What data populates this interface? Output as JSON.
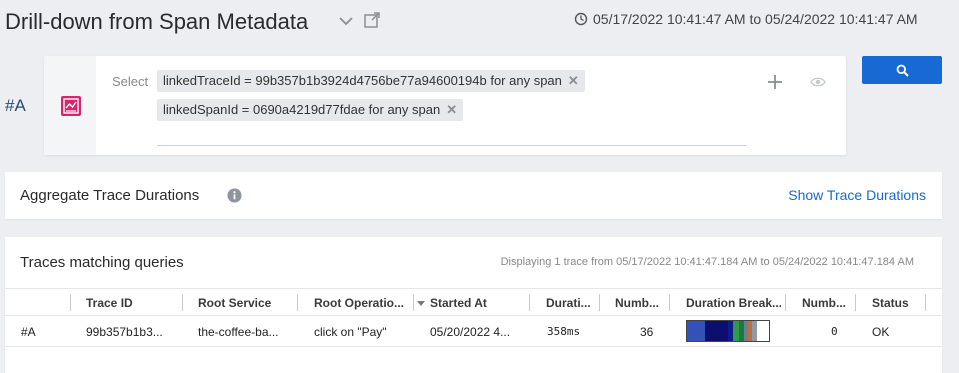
{
  "header": {
    "title": "Drill-down from Span Metadata",
    "time_range": "05/17/2022 10:41:47 AM to 05/24/2022 10:41:47 AM"
  },
  "query": {
    "label": "#A",
    "select_label": "Select",
    "filters": [
      "linkedTraceId = 99b357b1b3924d4756be77a94600194b for any span",
      "linkedSpanId = 0690a4219d77fdae for any span"
    ],
    "filter_remove_glyph": "✕"
  },
  "aggregate": {
    "title": "Aggregate Trace Durations",
    "action": "Show Trace Durations"
  },
  "traces": {
    "title": "Traces matching queries",
    "info": "Displaying 1 trace from 05/17/2022 10:41:47.184 AM to 05/24/2022 10:41:47.184 AM",
    "columns": [
      "",
      "Trace ID",
      "Root Service",
      "Root Operatio...",
      "Started At",
      "Durati...",
      "Numb...",
      "Duration Break...",
      "Numb...",
      "Status"
    ],
    "rows": [
      {
        "query": "#A",
        "trace_id": "99b357b1b3...",
        "root_service": "the-coffee-ba...",
        "root_operation": "click on \"Pay\"",
        "started_at": "05/20/2022 4...",
        "duration": "358ms",
        "spans": "36",
        "breakdown": [
          {
            "color": "#3352b8",
            "fraction": 0.22
          },
          {
            "color": "#0c0f6e",
            "fraction": 0.28
          },
          {
            "color": "#101a8a",
            "fraction": 0.06
          },
          {
            "color": "#2e9b4c",
            "fraction": 0.07
          },
          {
            "color": "#1a7a3a",
            "fraction": 0.06
          },
          {
            "color": "#6f7e8f",
            "fraction": 0.05
          },
          {
            "color": "#b8723f",
            "fraction": 0.05
          },
          {
            "color": "#8e9aa8",
            "fraction": 0.06
          }
        ],
        "errors": "0",
        "status": "OK"
      }
    ]
  },
  "colors": {
    "accent": "#1769d3",
    "query_icon": "#d6246e"
  },
  "icons": [
    "chevron-down-icon",
    "share-icon",
    "clock-icon",
    "query-type-icon",
    "add-icon",
    "eye-icon",
    "search-icon",
    "info-icon",
    "sort-desc-icon"
  ]
}
